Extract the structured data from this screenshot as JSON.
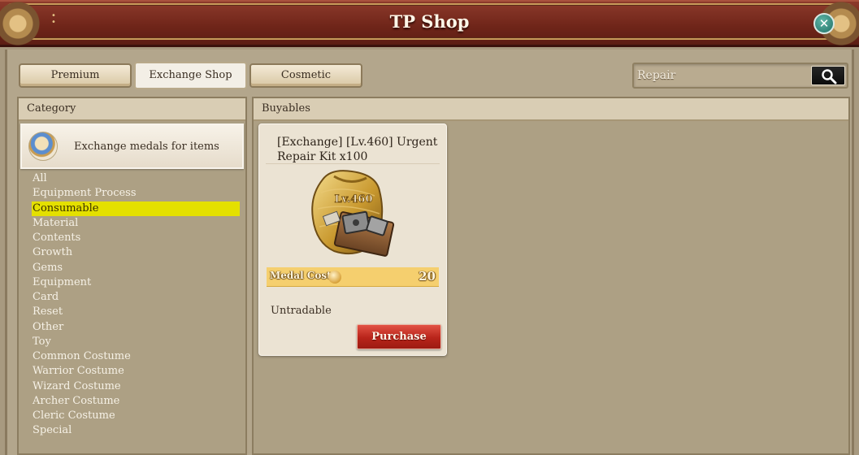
{
  "window": {
    "title": "TP Shop",
    "grip_icon": "drag-grip-icon",
    "close_icon": "close-icon",
    "close_glyph": "✕"
  },
  "tabs": [
    {
      "label": "Premium",
      "active": false
    },
    {
      "label": "Exchange Shop",
      "active": true
    },
    {
      "label": "Cosmetic",
      "active": false
    }
  ],
  "search": {
    "value": "Repair",
    "icon": "search-icon"
  },
  "category_panel": {
    "header": "Category",
    "banner_label": "Exchange medals for items",
    "banner_icon": "medal-icon",
    "items": [
      "All",
      "Equipment Process",
      "Consumable",
      "Material",
      "Contents",
      "Growth",
      "Gems",
      "Equipment",
      "Card",
      "Reset",
      "Other",
      "Toy",
      "Common Costume",
      "Warrior Costume",
      "Wizard Costume",
      "Archer Costume",
      "Cleric Costume",
      "Special"
    ],
    "selected": "Consumable",
    "highlight_color": "#e4e000"
  },
  "buyables_panel": {
    "header": "Buyables",
    "products": [
      {
        "title": "[Exchange] [Lv.460] Urgent Repair Kit x100",
        "image": "repair-kit-bag-icon",
        "level_badge": "Lv.460",
        "cost_label": "Medal Cost",
        "cost_icon": "medal-coin-icon",
        "cost_value": "20",
        "tradability": "Untradable",
        "action_label": "Purchase"
      }
    ]
  },
  "colors": {
    "title_bar": "#6f2519",
    "panel_bg": "#ada084",
    "cost_bar": "#f5cf6e",
    "purchase_button": "#b8241a"
  }
}
